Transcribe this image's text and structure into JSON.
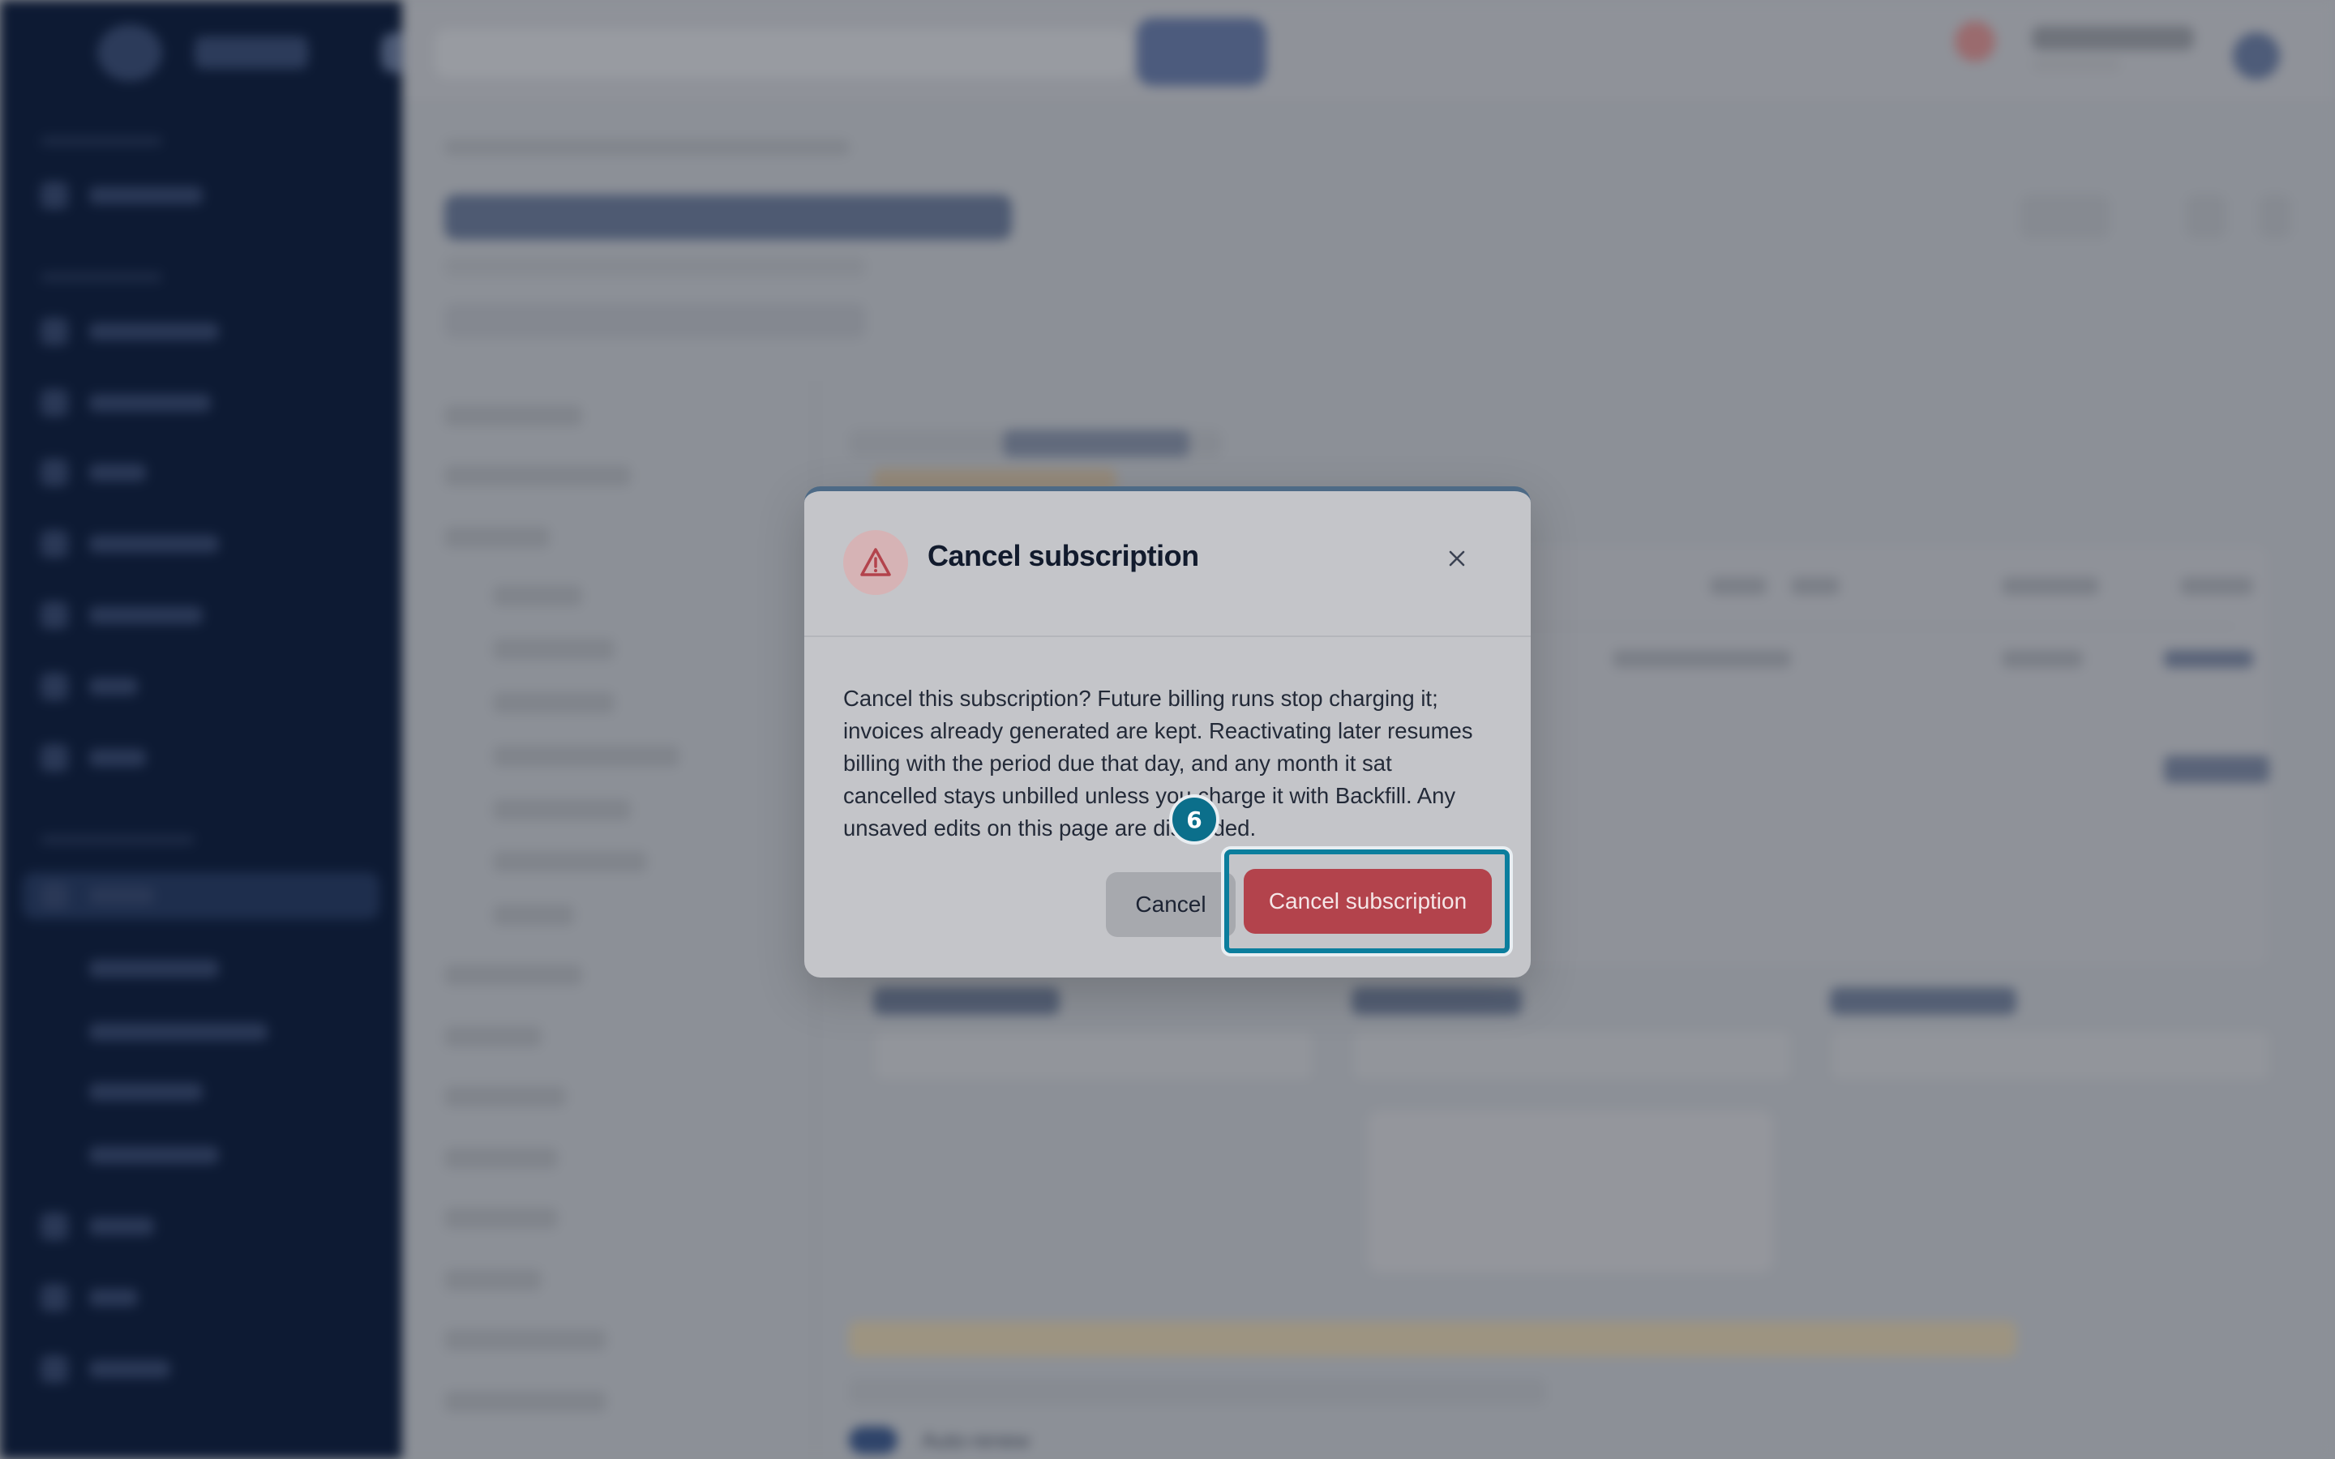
{
  "dialog": {
    "title": "Cancel subscription",
    "body": "Cancel this subscription? Future billing runs stop charging it; invoices already generated are kept. Reactivating later resumes billing with the period due that day, and any month it sat cancelled stays unbilled unless you charge it with Backfill. Any unsaved edits on this page are discarded.",
    "cancel_label": "Cancel",
    "confirm_label": "Cancel subscription",
    "icons": {
      "warning": "warning-triangle-icon",
      "close": "close-icon"
    }
  },
  "annotation": {
    "step_number": "6"
  },
  "background": {
    "auto_renew_label": "Auto-renew"
  },
  "colors": {
    "danger": "#b3434c",
    "highlight": "#0b7e9d",
    "sidebar": "#0d1a33"
  }
}
